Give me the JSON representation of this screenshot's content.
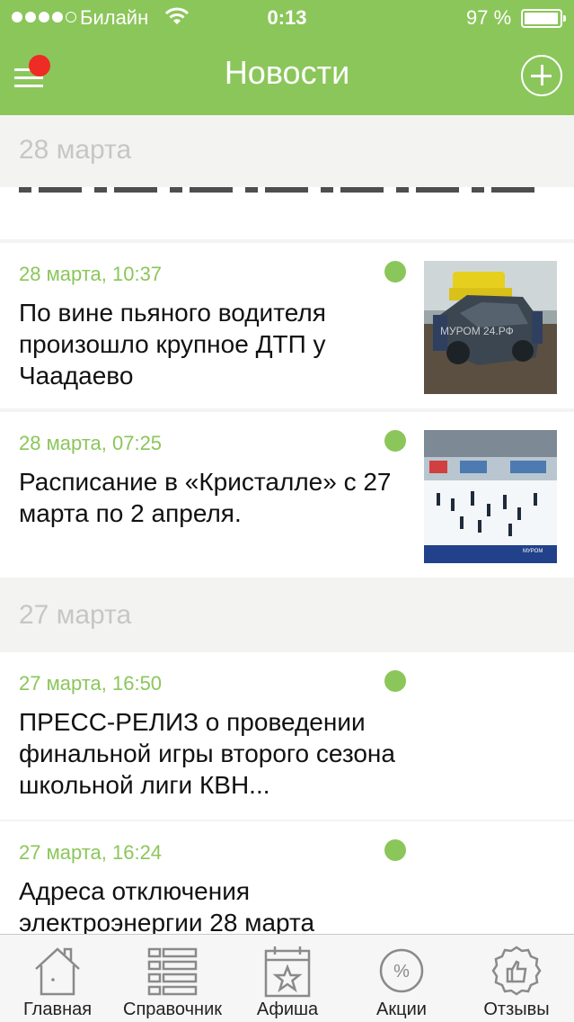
{
  "status_bar": {
    "carrier": "Билайн",
    "time": "0:13",
    "battery": "97 %",
    "battery_level": 0.97,
    "signal_bars": 4
  },
  "nav": {
    "title": "Новости"
  },
  "colors": {
    "accent": "#8bc65a",
    "badge": "#ee2b24",
    "section_text": "#c7c7c2"
  },
  "sections": [
    {
      "date": "28 марта"
    },
    {
      "date": "27 марта"
    }
  ],
  "news": [
    {
      "date": "28 марта, 10:37",
      "title": "По вине пьяного водителя произошло крупное ДТП у Чаадаево",
      "unread": true,
      "image": "car-crash-photo",
      "watermark": "МУРОМ 24.РФ"
    },
    {
      "date": "28 марта, 07:25",
      "title": "Расписание в «Кристалле» с 27 марта по 2 апреля.",
      "unread": true,
      "image": "ice-rink-photo",
      "watermark": "МУРОМ"
    },
    {
      "date": "27 марта, 16:50",
      "title": "ПРЕСС-РЕЛИЗ о проведении финальной игры второго сезона школьной лиги КВН...",
      "unread": true
    },
    {
      "date": "27 марта, 16:24",
      "title": "Адреса отключения электроэнергии 28 марта",
      "unread": true
    }
  ],
  "tabs": [
    {
      "label": "Главная",
      "icon": "home-icon"
    },
    {
      "label": "Справочник",
      "icon": "list-icon"
    },
    {
      "label": "Афиша",
      "icon": "calendar-star-icon"
    },
    {
      "label": "Акции",
      "icon": "percent-icon"
    },
    {
      "label": "Отзывы",
      "icon": "thumbs-up-badge-icon"
    }
  ]
}
